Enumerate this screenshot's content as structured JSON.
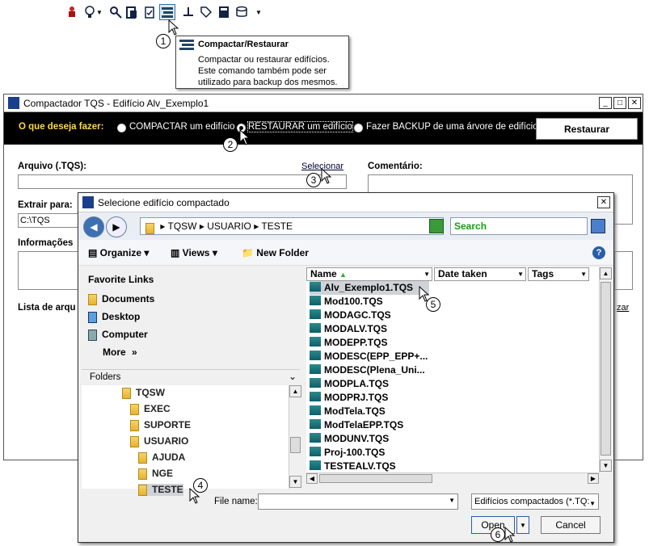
{
  "toolbar": {
    "icons": [
      "person-icon",
      "bulb-icon",
      "chevron-down-icon",
      "magnifier-icon",
      "building-icon",
      "clipboard-icon",
      "compact-restore-icon",
      "anchor-icon",
      "tag-icon",
      "calculator-icon",
      "database-icon",
      "dropdown-icon"
    ]
  },
  "callouts": [
    "1",
    "2",
    "3",
    "4",
    "5",
    "6"
  ],
  "tooltip": {
    "title": "Compactar/Restaurar",
    "body": "Compactar ou restaurar edifícios. Este comando também pode ser utilizado para backup dos mesmos."
  },
  "main": {
    "title": "Compactador TQS - Edifício Alv_Exemplo1",
    "question": "O que deseja fazer:",
    "options": [
      "COMPACTAR um edifício",
      "RESTAURAR um edifício",
      "Fazer BACKUP de uma árvore de edifícios"
    ],
    "selected_option": 1,
    "action_button": "Restaurar",
    "arquivo_label": "Arquivo (.TQS):",
    "selecionar_link": "Selecionar",
    "comentario_label": "Comentário:",
    "extrair_label": "Extrair para:",
    "extrair_value": "C:\\TQS",
    "informacoes_label": "Informações",
    "lista_label": "Lista de arqu",
    "right_link": "zar"
  },
  "dialog": {
    "title": "Selecione edifício compactado",
    "path": [
      "TQSW",
      "USUARIO",
      "TESTE"
    ],
    "search_placeholder": "Search",
    "organize": "Organize",
    "views": "Views",
    "new_folder": "New Folder",
    "favorites_title": "Favorite Links",
    "favorites": [
      "Documents",
      "Desktop",
      "Computer"
    ],
    "more": "More",
    "more_arrow": "»",
    "folders_label": "Folders",
    "tree": [
      "TQSW",
      "EXEC",
      "SUPORTE",
      "USUARIO",
      "AJUDA",
      "NGE",
      "TESTE"
    ],
    "columns": [
      "Name",
      "Date taken",
      "Tags"
    ],
    "files": [
      "Alv_Exemplo1.TQS",
      "Mod100.TQS",
      "MODAGC.TQS",
      "MODALV.TQS",
      "MODEPP.TQS",
      "MODESC(EPP_EPP+...",
      "MODESC(Plena_Uni...",
      "MODPLA.TQS",
      "MODPRJ.TQS",
      "ModTela.TQS",
      "ModTelaEPP.TQS",
      "MODUNV.TQS",
      "Proj-100.TQS",
      "TESTEALV.TQS"
    ],
    "selected_file": 0,
    "filename_label": "File name:",
    "filename_value": "",
    "filetype": "Edifícios compactados (*.TQ:",
    "open_button": "Open",
    "cancel_button": "Cancel"
  }
}
